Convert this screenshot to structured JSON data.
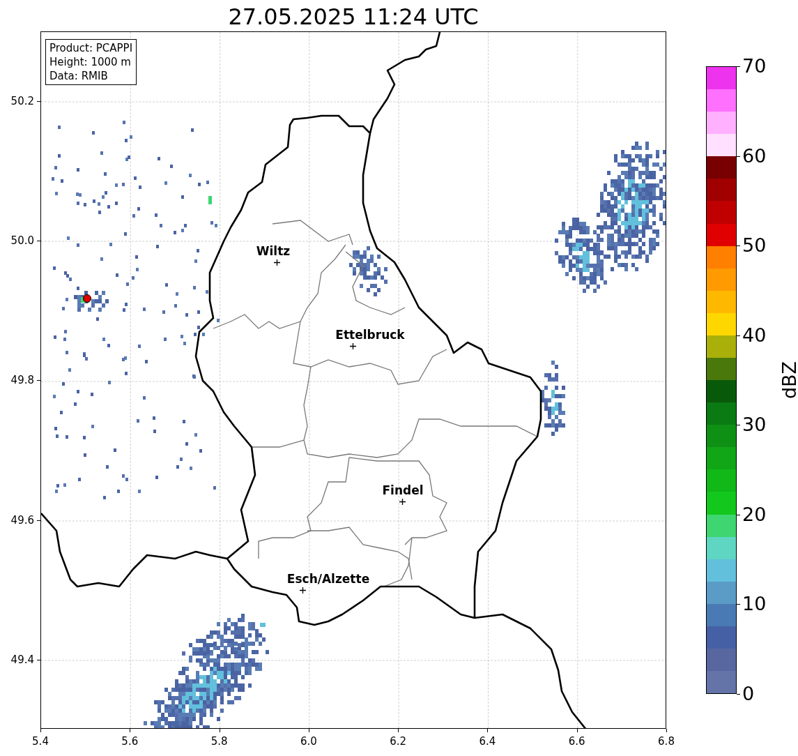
{
  "title": "27.05.2025 11:24 UTC",
  "info_box": [
    "Product: PCAPPI",
    "Height: 1000 m",
    "Data: RMIB"
  ],
  "cities": [
    {
      "name": "Wiltz"
    },
    {
      "name": "Ettelbruck"
    },
    {
      "name": "Findel"
    },
    {
      "name": "Esch/Alzette"
    }
  ],
  "x_ticks": [
    "5.4",
    "5.6",
    "5.8",
    "6.0",
    "6.2",
    "6.4",
    "6.6",
    "6.8"
  ],
  "y_ticks": [
    "50.2",
    "50.0",
    "49.8",
    "49.6",
    "49.4"
  ],
  "colorbar": {
    "label": "dBZ",
    "ticks": [
      "70",
      "60",
      "50",
      "40",
      "30",
      "20",
      "10",
      "0"
    ],
    "segments": [
      {
        "color": "#ee33ee"
      },
      {
        "color": "#ff70ff"
      },
      {
        "color": "#ffb0ff"
      },
      {
        "color": "#ffe0ff"
      },
      {
        "color": "#780000"
      },
      {
        "color": "#a00000"
      },
      {
        "color": "#c00000"
      },
      {
        "color": "#e00000"
      },
      {
        "color": "#ff7f00"
      },
      {
        "color": "#ff9a00"
      },
      {
        "color": "#ffb800"
      },
      {
        "color": "#ffd700"
      },
      {
        "color": "#aab00a"
      },
      {
        "color": "#4a780a"
      },
      {
        "color": "#085a0a"
      },
      {
        "color": "#0a7a12"
      },
      {
        "color": "#0e9014"
      },
      {
        "color": "#10a616"
      },
      {
        "color": "#10b818"
      },
      {
        "color": "#12c81c"
      },
      {
        "color": "#3dd670"
      },
      {
        "color": "#5ed6c2"
      },
      {
        "color": "#62c0dc"
      },
      {
        "color": "#5a9cc6"
      },
      {
        "color": "#4a7ab3"
      },
      {
        "color": "#4660a5"
      },
      {
        "color": "#5867a0"
      },
      {
        "color": "#6474a8"
      }
    ]
  }
}
